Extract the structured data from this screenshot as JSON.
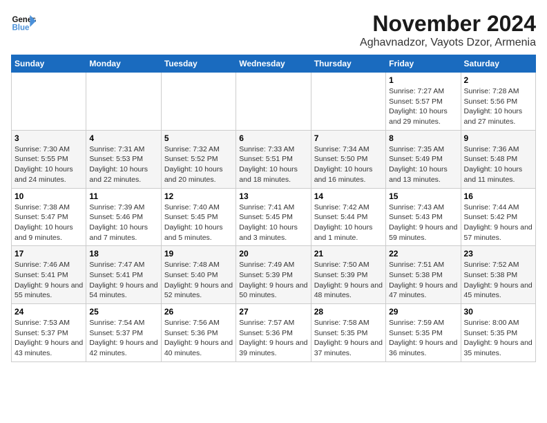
{
  "header": {
    "logo_line1": "General",
    "logo_line2": "Blue",
    "month_title": "November 2024",
    "location": "Aghavnadzor, Vayots Dzor, Armenia"
  },
  "weekdays": [
    "Sunday",
    "Monday",
    "Tuesday",
    "Wednesday",
    "Thursday",
    "Friday",
    "Saturday"
  ],
  "weeks": [
    [
      {
        "day": "",
        "info": ""
      },
      {
        "day": "",
        "info": ""
      },
      {
        "day": "",
        "info": ""
      },
      {
        "day": "",
        "info": ""
      },
      {
        "day": "",
        "info": ""
      },
      {
        "day": "1",
        "info": "Sunrise: 7:27 AM\nSunset: 5:57 PM\nDaylight: 10 hours and 29 minutes."
      },
      {
        "day": "2",
        "info": "Sunrise: 7:28 AM\nSunset: 5:56 PM\nDaylight: 10 hours and 27 minutes."
      }
    ],
    [
      {
        "day": "3",
        "info": "Sunrise: 7:30 AM\nSunset: 5:55 PM\nDaylight: 10 hours and 24 minutes."
      },
      {
        "day": "4",
        "info": "Sunrise: 7:31 AM\nSunset: 5:53 PM\nDaylight: 10 hours and 22 minutes."
      },
      {
        "day": "5",
        "info": "Sunrise: 7:32 AM\nSunset: 5:52 PM\nDaylight: 10 hours and 20 minutes."
      },
      {
        "day": "6",
        "info": "Sunrise: 7:33 AM\nSunset: 5:51 PM\nDaylight: 10 hours and 18 minutes."
      },
      {
        "day": "7",
        "info": "Sunrise: 7:34 AM\nSunset: 5:50 PM\nDaylight: 10 hours and 16 minutes."
      },
      {
        "day": "8",
        "info": "Sunrise: 7:35 AM\nSunset: 5:49 PM\nDaylight: 10 hours and 13 minutes."
      },
      {
        "day": "9",
        "info": "Sunrise: 7:36 AM\nSunset: 5:48 PM\nDaylight: 10 hours and 11 minutes."
      }
    ],
    [
      {
        "day": "10",
        "info": "Sunrise: 7:38 AM\nSunset: 5:47 PM\nDaylight: 10 hours and 9 minutes."
      },
      {
        "day": "11",
        "info": "Sunrise: 7:39 AM\nSunset: 5:46 PM\nDaylight: 10 hours and 7 minutes."
      },
      {
        "day": "12",
        "info": "Sunrise: 7:40 AM\nSunset: 5:45 PM\nDaylight: 10 hours and 5 minutes."
      },
      {
        "day": "13",
        "info": "Sunrise: 7:41 AM\nSunset: 5:45 PM\nDaylight: 10 hours and 3 minutes."
      },
      {
        "day": "14",
        "info": "Sunrise: 7:42 AM\nSunset: 5:44 PM\nDaylight: 10 hours and 1 minute."
      },
      {
        "day": "15",
        "info": "Sunrise: 7:43 AM\nSunset: 5:43 PM\nDaylight: 9 hours and 59 minutes."
      },
      {
        "day": "16",
        "info": "Sunrise: 7:44 AM\nSunset: 5:42 PM\nDaylight: 9 hours and 57 minutes."
      }
    ],
    [
      {
        "day": "17",
        "info": "Sunrise: 7:46 AM\nSunset: 5:41 PM\nDaylight: 9 hours and 55 minutes."
      },
      {
        "day": "18",
        "info": "Sunrise: 7:47 AM\nSunset: 5:41 PM\nDaylight: 9 hours and 54 minutes."
      },
      {
        "day": "19",
        "info": "Sunrise: 7:48 AM\nSunset: 5:40 PM\nDaylight: 9 hours and 52 minutes."
      },
      {
        "day": "20",
        "info": "Sunrise: 7:49 AM\nSunset: 5:39 PM\nDaylight: 9 hours and 50 minutes."
      },
      {
        "day": "21",
        "info": "Sunrise: 7:50 AM\nSunset: 5:39 PM\nDaylight: 9 hours and 48 minutes."
      },
      {
        "day": "22",
        "info": "Sunrise: 7:51 AM\nSunset: 5:38 PM\nDaylight: 9 hours and 47 minutes."
      },
      {
        "day": "23",
        "info": "Sunrise: 7:52 AM\nSunset: 5:38 PM\nDaylight: 9 hours and 45 minutes."
      }
    ],
    [
      {
        "day": "24",
        "info": "Sunrise: 7:53 AM\nSunset: 5:37 PM\nDaylight: 9 hours and 43 minutes."
      },
      {
        "day": "25",
        "info": "Sunrise: 7:54 AM\nSunset: 5:37 PM\nDaylight: 9 hours and 42 minutes."
      },
      {
        "day": "26",
        "info": "Sunrise: 7:56 AM\nSunset: 5:36 PM\nDaylight: 9 hours and 40 minutes."
      },
      {
        "day": "27",
        "info": "Sunrise: 7:57 AM\nSunset: 5:36 PM\nDaylight: 9 hours and 39 minutes."
      },
      {
        "day": "28",
        "info": "Sunrise: 7:58 AM\nSunset: 5:35 PM\nDaylight: 9 hours and 37 minutes."
      },
      {
        "day": "29",
        "info": "Sunrise: 7:59 AM\nSunset: 5:35 PM\nDaylight: 9 hours and 36 minutes."
      },
      {
        "day": "30",
        "info": "Sunrise: 8:00 AM\nSunset: 5:35 PM\nDaylight: 9 hours and 35 minutes."
      }
    ]
  ]
}
